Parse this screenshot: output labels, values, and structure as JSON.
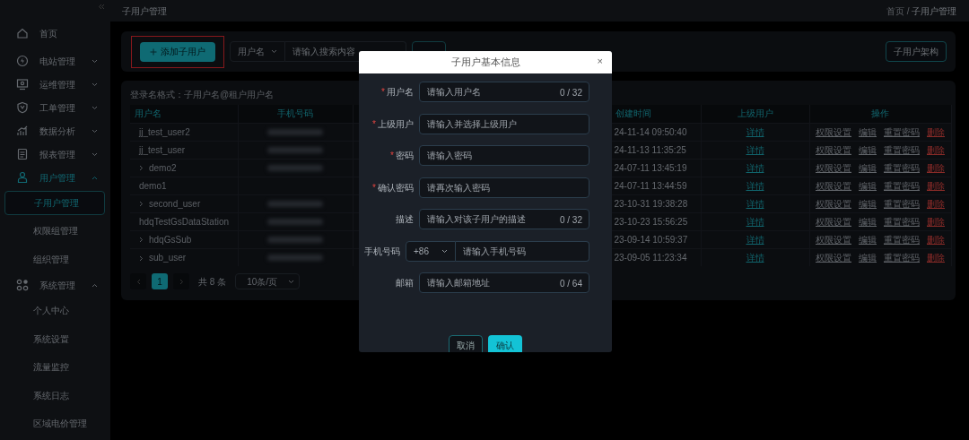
{
  "sidebar": {
    "items": [
      {
        "label": "首页",
        "selected": false
      },
      {
        "label": "电站管理",
        "selected": false,
        "expanded": false
      },
      {
        "label": "运维管理",
        "selected": false,
        "expanded": false
      },
      {
        "label": "工单管理",
        "selected": false,
        "expanded": false
      },
      {
        "label": "数据分析",
        "selected": false,
        "expanded": false
      },
      {
        "label": "报表管理",
        "selected": false,
        "expanded": false
      },
      {
        "label": "用户管理",
        "selected": true,
        "expanded": true,
        "children": [
          {
            "label": "子用户管理",
            "selected": true
          },
          {
            "label": "权限组管理",
            "selected": false
          },
          {
            "label": "组织管理",
            "selected": false
          }
        ]
      },
      {
        "label": "系统管理",
        "selected": false,
        "expanded": true,
        "children": [
          {
            "label": "个人中心",
            "selected": false
          },
          {
            "label": "系统设置",
            "selected": false
          },
          {
            "label": "流量监控",
            "selected": false
          },
          {
            "label": "系统日志",
            "selected": false
          },
          {
            "label": "区域电价管理",
            "selected": false
          }
        ]
      }
    ]
  },
  "header": {
    "title": "子用户管理",
    "breadcrumb": [
      "首页",
      "子用户管理"
    ],
    "separator": "/"
  },
  "toolbar": {
    "add_button": {
      "label": "添加子用户",
      "highlighted": true
    },
    "search_select": "用户名",
    "search_placeholder": "请输入搜索内容",
    "structure_button": "子用户架构"
  },
  "table": {
    "note": "登录名格式：子用户名@租户用户名",
    "columns": [
      "用户名",
      "手机号码",
      "创建时间",
      "上级用户",
      "操作"
    ],
    "rows": [
      {
        "name": "jj_test_user2",
        "expandable": false,
        "phone_redacted": true,
        "created": "24-11-14 09:50:40",
        "parent": "详情",
        "actions": [
          {
            "label": "权限设置",
            "kind": "normal"
          },
          {
            "label": "编辑",
            "kind": "normal"
          },
          {
            "label": "重置密码",
            "kind": "normal"
          },
          {
            "label": "删除",
            "kind": "danger"
          }
        ]
      },
      {
        "name": "jj_test_user",
        "expandable": false,
        "phone_redacted": true,
        "created": "24-11-13 11:35:25",
        "parent": "详情",
        "actions": [
          {
            "label": "权限设置",
            "kind": "normal"
          },
          {
            "label": "编辑",
            "kind": "normal"
          },
          {
            "label": "重置密码",
            "kind": "normal"
          },
          {
            "label": "删除",
            "kind": "danger"
          }
        ]
      },
      {
        "name": "demo2",
        "expandable": true,
        "phone_redacted": true,
        "created": "24-07-11 13:45:19",
        "parent": "详情",
        "actions": [
          {
            "label": "权限设置",
            "kind": "normal"
          },
          {
            "label": "编辑",
            "kind": "normal"
          },
          {
            "label": "重置密码",
            "kind": "normal"
          },
          {
            "label": "删除",
            "kind": "danger"
          }
        ]
      },
      {
        "name": "demo1",
        "expandable": false,
        "phone_redacted": false,
        "created": "24-07-11 13:44:59",
        "parent": "详情",
        "actions": [
          {
            "label": "权限设置",
            "kind": "normal"
          },
          {
            "label": "编辑",
            "kind": "normal"
          },
          {
            "label": "重置密码",
            "kind": "normal"
          },
          {
            "label": "删除",
            "kind": "danger"
          }
        ]
      },
      {
        "name": "second_user",
        "expandable": true,
        "phone_redacted": true,
        "created": "23-10-31 19:38:28",
        "parent": "详情",
        "actions": [
          {
            "label": "权限设置",
            "kind": "normal"
          },
          {
            "label": "编辑",
            "kind": "normal"
          },
          {
            "label": "重置密码",
            "kind": "normal"
          },
          {
            "label": "删除",
            "kind": "danger"
          }
        ]
      },
      {
        "name": "hdqTestGsDataStation",
        "expandable": false,
        "phone_redacted": true,
        "created": "23-10-23 15:56:25",
        "parent": "详情",
        "actions": [
          {
            "label": "权限设置",
            "kind": "normal"
          },
          {
            "label": "编辑",
            "kind": "normal"
          },
          {
            "label": "重置密码",
            "kind": "normal"
          },
          {
            "label": "删除",
            "kind": "danger"
          }
        ]
      },
      {
        "name": "hdqGsSub",
        "expandable": true,
        "phone_redacted": true,
        "created": "23-09-14 10:59:37",
        "parent": "详情",
        "actions": [
          {
            "label": "权限设置",
            "kind": "normal"
          },
          {
            "label": "编辑",
            "kind": "normal"
          },
          {
            "label": "重置密码",
            "kind": "normal"
          },
          {
            "label": "删除",
            "kind": "danger"
          }
        ]
      },
      {
        "name": "sub_user",
        "expandable": true,
        "phone_redacted": true,
        "created": "23-09-05 11:23:34",
        "parent": "详情",
        "actions": [
          {
            "label": "权限设置",
            "kind": "normal"
          },
          {
            "label": "编辑",
            "kind": "normal"
          },
          {
            "label": "重置密码",
            "kind": "normal"
          },
          {
            "label": "删除",
            "kind": "danger"
          }
        ]
      }
    ]
  },
  "pagination": {
    "pages": [
      {
        "label": "1",
        "selected": true
      }
    ],
    "total": "共 8 条",
    "page_size": "10条/页"
  },
  "modal": {
    "title": "子用户基本信息",
    "close": "×",
    "fields": [
      {
        "kind": "text",
        "label": "用户名",
        "mark": "*",
        "placeholder": "请输入用户名",
        "counter": "0 / 32"
      },
      {
        "kind": "text",
        "label": "上级用户",
        "mark": "*",
        "placeholder": "请输入并选择上级用户"
      },
      {
        "kind": "text",
        "label": "密码",
        "mark": "*",
        "placeholder": "请输入密码"
      },
      {
        "kind": "text",
        "label": "确认密码",
        "mark": "*",
        "placeholder": "请再次输入密码"
      },
      {
        "kind": "text",
        "label": "描述",
        "placeholder": "请输入对该子用户的描述",
        "counter": "0 / 32"
      },
      {
        "kind": "phone",
        "label": "手机号码",
        "code": "+86",
        "placeholder": "请输入手机号码"
      },
      {
        "kind": "text",
        "label": "邮箱",
        "placeholder": "请输入邮箱地址",
        "counter": "0 / 64"
      }
    ],
    "buttons": [
      {
        "label": "取消",
        "kind": "secondary"
      },
      {
        "label": "确认",
        "kind": "primary"
      }
    ]
  }
}
